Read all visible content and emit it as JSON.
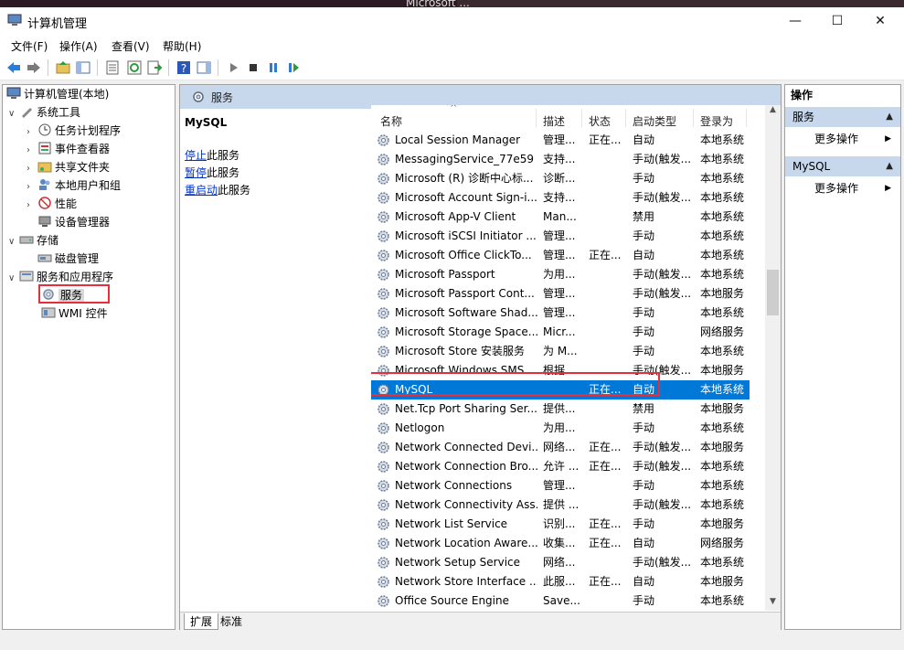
{
  "window": {
    "title": "计算机管理",
    "background_title": "Microsoft ...",
    "minimize": "—",
    "maximize": "☐",
    "close": "✕"
  },
  "menu": [
    "文件(F)",
    "操作(A)",
    "查看(V)",
    "帮助(H)"
  ],
  "tree": {
    "root": "计算机管理(本地)",
    "system_tools": "系统工具",
    "task_scheduler": "任务计划程序",
    "event_viewer": "事件查看器",
    "shared_folders": "共享文件夹",
    "local_users": "本地用户和组",
    "performance": "性能",
    "device_manager": "设备管理器",
    "storage": "存储",
    "disk_management": "磁盘管理",
    "services_apps": "服务和应用程序",
    "services": "服务",
    "wmi": "WMI 控件"
  },
  "center": {
    "title": "服务",
    "selected_service": "MySQL",
    "stop_link": "停止",
    "stop_suffix": "此服务",
    "pause_link": "暂停",
    "pause_suffix": "此服务",
    "restart_link": "重启动",
    "restart_suffix": "此服务",
    "columns": {
      "name": "名称",
      "desc": "描述",
      "status": "状态",
      "startup": "启动类型",
      "logon": "登录为"
    },
    "rows": [
      {
        "name": "Local Session Manager",
        "desc": "管理...",
        "status": "正在...",
        "startup": "自动",
        "logon": "本地系统"
      },
      {
        "name": "MessagingService_77e59",
        "desc": "支持...",
        "status": "",
        "startup": "手动(触发...",
        "logon": "本地系统"
      },
      {
        "name": "Microsoft (R) 诊断中心标...",
        "desc": "诊断...",
        "status": "",
        "startup": "手动",
        "logon": "本地系统"
      },
      {
        "name": "Microsoft Account Sign-i...",
        "desc": "支持...",
        "status": "",
        "startup": "手动(触发...",
        "logon": "本地系统"
      },
      {
        "name": "Microsoft App-V Client",
        "desc": "Man...",
        "status": "",
        "startup": "禁用",
        "logon": "本地系统"
      },
      {
        "name": "Microsoft iSCSI Initiator ...",
        "desc": "管理...",
        "status": "",
        "startup": "手动",
        "logon": "本地系统"
      },
      {
        "name": "Microsoft Office ClickTo...",
        "desc": "管理...",
        "status": "正在...",
        "startup": "自动",
        "logon": "本地系统"
      },
      {
        "name": "Microsoft Passport",
        "desc": "为用...",
        "status": "",
        "startup": "手动(触发...",
        "logon": "本地系统"
      },
      {
        "name": "Microsoft Passport Cont...",
        "desc": "管理...",
        "status": "",
        "startup": "手动(触发...",
        "logon": "本地服务"
      },
      {
        "name": "Microsoft Software Shad...",
        "desc": "管理...",
        "status": "",
        "startup": "手动",
        "logon": "本地系统"
      },
      {
        "name": "Microsoft Storage Space...",
        "desc": "Micr...",
        "status": "",
        "startup": "手动",
        "logon": "网络服务"
      },
      {
        "name": "Microsoft Store 安装服务",
        "desc": "为 M...",
        "status": "",
        "startup": "手动",
        "logon": "本地系统"
      },
      {
        "name": "Microsoft Windows SMS ...",
        "desc": "根据...",
        "status": "",
        "startup": "手动(触发...",
        "logon": "本地服务"
      },
      {
        "name": "MySQL",
        "desc": "",
        "status": "正在...",
        "startup": "自动",
        "logon": "本地系统",
        "selected": true
      },
      {
        "name": "Net.Tcp Port Sharing Ser...",
        "desc": "提供...",
        "status": "",
        "startup": "禁用",
        "logon": "本地服务"
      },
      {
        "name": "Netlogon",
        "desc": "为用...",
        "status": "",
        "startup": "手动",
        "logon": "本地系统"
      },
      {
        "name": "Network Connected Devi...",
        "desc": "网络...",
        "status": "正在...",
        "startup": "手动(触发...",
        "logon": "本地服务"
      },
      {
        "name": "Network Connection Bro...",
        "desc": "允许 ...",
        "status": "正在...",
        "startup": "手动(触发...",
        "logon": "本地系统"
      },
      {
        "name": "Network Connections",
        "desc": "管理...",
        "status": "",
        "startup": "手动",
        "logon": "本地系统"
      },
      {
        "name": "Network Connectivity Ass...",
        "desc": "提供 ...",
        "status": "",
        "startup": "手动(触发...",
        "logon": "本地系统"
      },
      {
        "name": "Network List Service",
        "desc": "识别...",
        "status": "正在...",
        "startup": "手动",
        "logon": "本地服务"
      },
      {
        "name": "Network Location Aware...",
        "desc": "收集...",
        "status": "正在...",
        "startup": "自动",
        "logon": "网络服务"
      },
      {
        "name": "Network Setup Service",
        "desc": "网络...",
        "status": "",
        "startup": "手动(触发...",
        "logon": "本地系统"
      },
      {
        "name": "Network Store Interface ...",
        "desc": "此服...",
        "status": "正在...",
        "startup": "自动",
        "logon": "本地服务"
      },
      {
        "name": "Office  Source Engine",
        "desc": "Save...",
        "status": "",
        "startup": "手动",
        "logon": "本地系统"
      }
    ],
    "tab_extended": "扩展",
    "tab_standard": "标准"
  },
  "actions": {
    "header": "操作",
    "section1": "服务",
    "section1_more": "更多操作",
    "section2": "MySQL",
    "section2_more": "更多操作"
  },
  "colors": {
    "header_blue": "#c7d8ec",
    "selection_blue": "#0078d7",
    "highlight_red": "#e5303b"
  }
}
